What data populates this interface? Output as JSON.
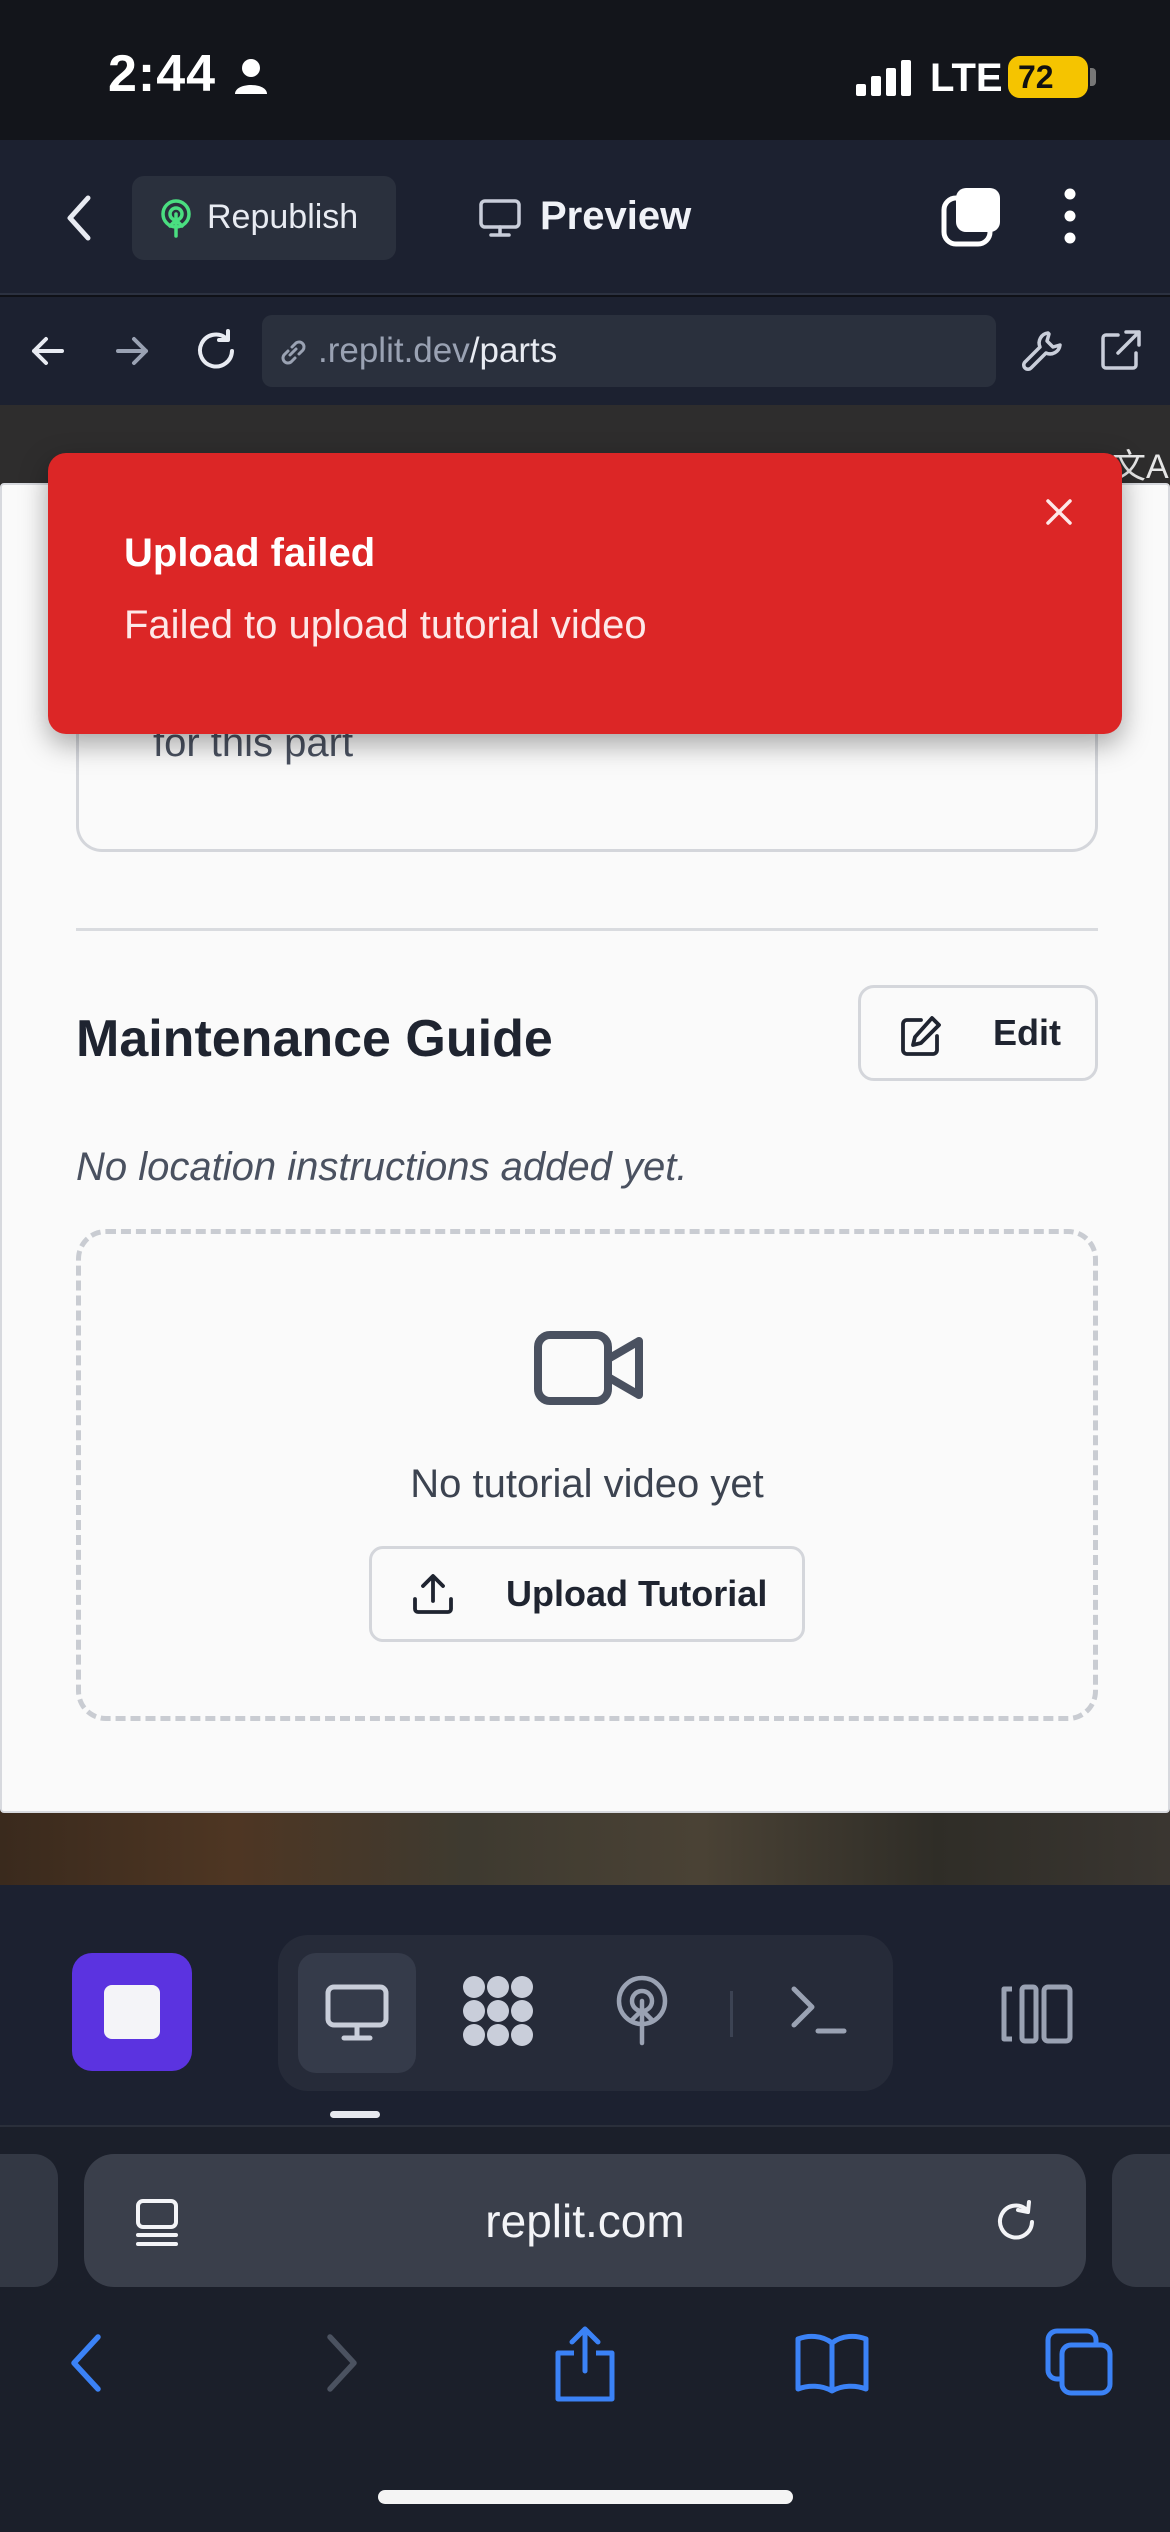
{
  "status_bar": {
    "time": "2:44",
    "network": "LTE",
    "battery": "72"
  },
  "replit_header": {
    "republish_label": "Republish",
    "preview_label": "Preview"
  },
  "url_bar": {
    "url_host": ".replit.dev",
    "url_path": "/parts"
  },
  "toast": {
    "title": "Upload failed",
    "message": "Failed to upload tutorial video"
  },
  "page": {
    "previous_text": "for this part",
    "section_title": "Maintenance Guide",
    "edit_label": "Edit",
    "location_note": "No location instructions added yet.",
    "empty_video_text": "No tutorial video yet",
    "upload_label": "Upload Tutorial"
  },
  "safari": {
    "address": "replit.com"
  },
  "colors": {
    "toast_bg": "#dc2626",
    "stop_button": "#5b33e0",
    "safari_accent": "#3b82f6"
  }
}
